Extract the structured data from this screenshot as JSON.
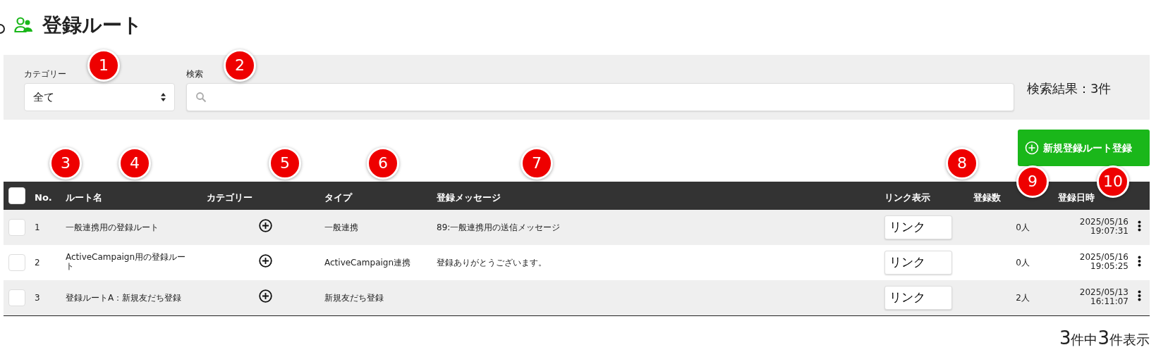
{
  "page": {
    "title": "登録ルート"
  },
  "filters": {
    "category": {
      "label": "カテゴリー",
      "value": "全て"
    },
    "search": {
      "label": "検索"
    },
    "result": "検索結果：3件"
  },
  "new_button": {
    "label": "新規登録ルート登録"
  },
  "table": {
    "select_all": {
      "checked": false
    },
    "columns": [
      "No.",
      "ルート名",
      "カテゴリー",
      "タイプ",
      "登録メッセージ",
      "リンク表示",
      "登録数",
      "登録日時"
    ],
    "rows": [
      {
        "checked": false,
        "no": "1",
        "name": "一般連携用の登録ルート",
        "type": "一般連携",
        "message": "89:一般連携用の送信メッセージ",
        "link": "リンク",
        "count": "0人",
        "date": "2025/05/16",
        "time": "19:07:31"
      },
      {
        "checked": false,
        "no": "2",
        "name": "ActiveCampaign用の登録ルート",
        "type": "ActiveCampaign連携",
        "message": "登録ありがとうございます。",
        "link": "リンク",
        "count": "0人",
        "date": "2025/05/16",
        "time": "19:05:25"
      },
      {
        "checked": false,
        "no": "3",
        "name": "登録ルートA：新規友だち登録",
        "type": "新規友だち登録",
        "link": "リンク",
        "count": "2人",
        "date": "2025/05/13",
        "time": "16:11:07"
      }
    ]
  },
  "footer": {
    "total": "3",
    "total_unit": "件中",
    "shown": "3",
    "shown_unit": "件表示"
  },
  "callouts": [
    "1",
    "2",
    "3",
    "4",
    "5",
    "6",
    "7",
    "8",
    "9",
    "10"
  ]
}
